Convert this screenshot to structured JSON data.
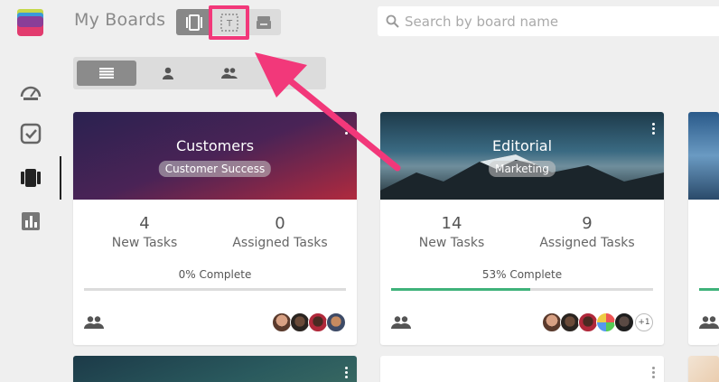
{
  "header": {
    "title": "My Boards",
    "search_placeholder": "Search by board name"
  },
  "colors": {
    "highlight": "#f2387a",
    "progress": "#3fb27a"
  },
  "boards": [
    {
      "title": "Customers",
      "tag": "Customer Success",
      "new_tasks": "4",
      "new_tasks_label": "New Tasks",
      "assigned_tasks": "0",
      "assigned_tasks_label": "Assigned Tasks",
      "complete_text": "0% Complete",
      "progress": 0
    },
    {
      "title": "Editorial",
      "tag": "Marketing",
      "new_tasks": "14",
      "new_tasks_label": "New Tasks",
      "assigned_tasks": "9",
      "assigned_tasks_label": "Assigned Tasks",
      "complete_text": "53% Complete",
      "progress": 0.53,
      "extra_members": "+1"
    }
  ]
}
